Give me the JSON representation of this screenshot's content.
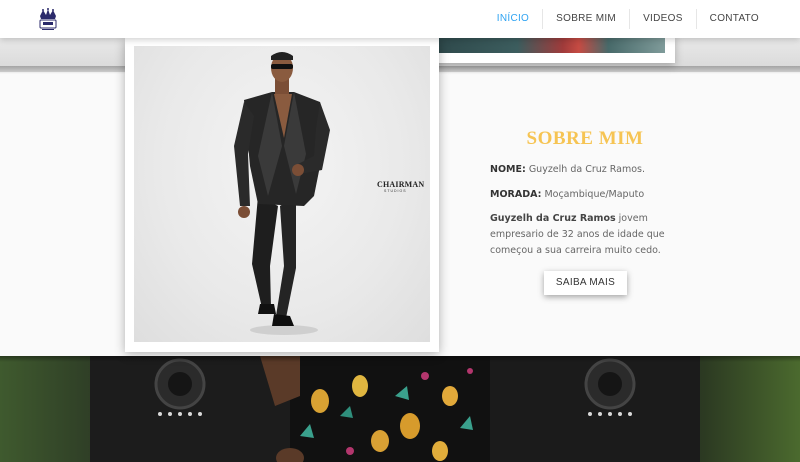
{
  "header": {
    "logo_icon": "crown-logo-icon",
    "nav": [
      {
        "label": "INÍCIO",
        "active": true
      },
      {
        "label": "SOBRE MIM",
        "active": false
      },
      {
        "label": "VIDEOS",
        "active": false
      },
      {
        "label": "CONTATO",
        "active": false
      }
    ],
    "accent_color": "#2ea3f2"
  },
  "about": {
    "title": "SOBRE MIM",
    "title_color": "#f6c453",
    "name_label": "NOME:",
    "name_value": "Guyzelh da Cruz Ramos.",
    "address_label": "MORADA:",
    "address_value": "Moçambique/Maputo",
    "bio_bold": "Guyzelh da  Cruz Ramos",
    "bio_text": " jovem empresario de 32 anos de idade que começou a sua carreira muito cedo.",
    "button_label": "SAIBA MAIS",
    "photo_logo": "CHAIRMAN",
    "photo_logo_sub": "STUDIOS"
  }
}
